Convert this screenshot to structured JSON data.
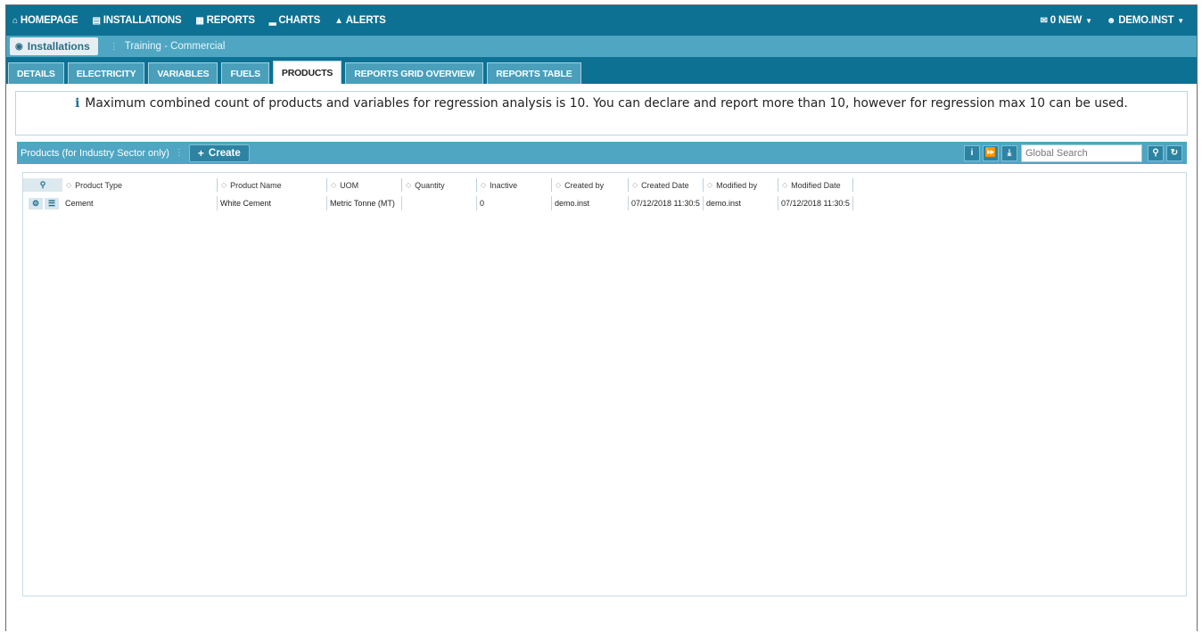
{
  "nav": {
    "items": [
      {
        "icon": "home-icon",
        "glyph": "⌂",
        "label": "HOMEPAGE"
      },
      {
        "icon": "industry-icon",
        "glyph": "▤",
        "label": "INSTALLATIONS"
      },
      {
        "icon": "table-icon",
        "glyph": "▦",
        "label": "REPORTS"
      },
      {
        "icon": "chart-icon",
        "glyph": "▁",
        "label": "CHARTS"
      },
      {
        "icon": "warning-icon",
        "glyph": "▲",
        "label": "ALERTS"
      }
    ],
    "messages": {
      "icon": "envelope-icon",
      "label": "0 NEW"
    },
    "user": {
      "icon": "user-icon",
      "label": "DEMO.INST"
    }
  },
  "breadcrumb": {
    "main": "Installations",
    "sub": "Training - Commercial"
  },
  "tabs": [
    {
      "label": "DETAILS"
    },
    {
      "label": "ELECTRICITY"
    },
    {
      "label": "VARIABLES"
    },
    {
      "label": "FUELS"
    },
    {
      "label": "PRODUCTS",
      "active": true
    },
    {
      "label": "REPORTS GRID OVERVIEW"
    },
    {
      "label": "REPORTS TABLE"
    }
  ],
  "info": {
    "text": "Maximum combined count of products and variables for regression analysis is 10. You can declare and report more than 10, however for regression max 10 can be used."
  },
  "grid": {
    "title": "Products (for Industry Sector only)",
    "create_label": "Create",
    "search_placeholder": "Global Search",
    "columns": [
      "Product Type",
      "Product Name",
      "UOM",
      "Quantity",
      "Inactive",
      "Created by",
      "Created Date",
      "Modified by",
      "Modified Date"
    ],
    "rows": [
      [
        "Cement",
        "White Cement",
        "Metric Tonne (MT)",
        "",
        "0",
        "demo.inst",
        "07/12/2018 11:30:5",
        "demo.inst",
        "07/12/2018 11:30:5"
      ]
    ]
  },
  "colors": {
    "nav_bg": "#0d7193",
    "bar_bg": "#4ea6c2"
  }
}
